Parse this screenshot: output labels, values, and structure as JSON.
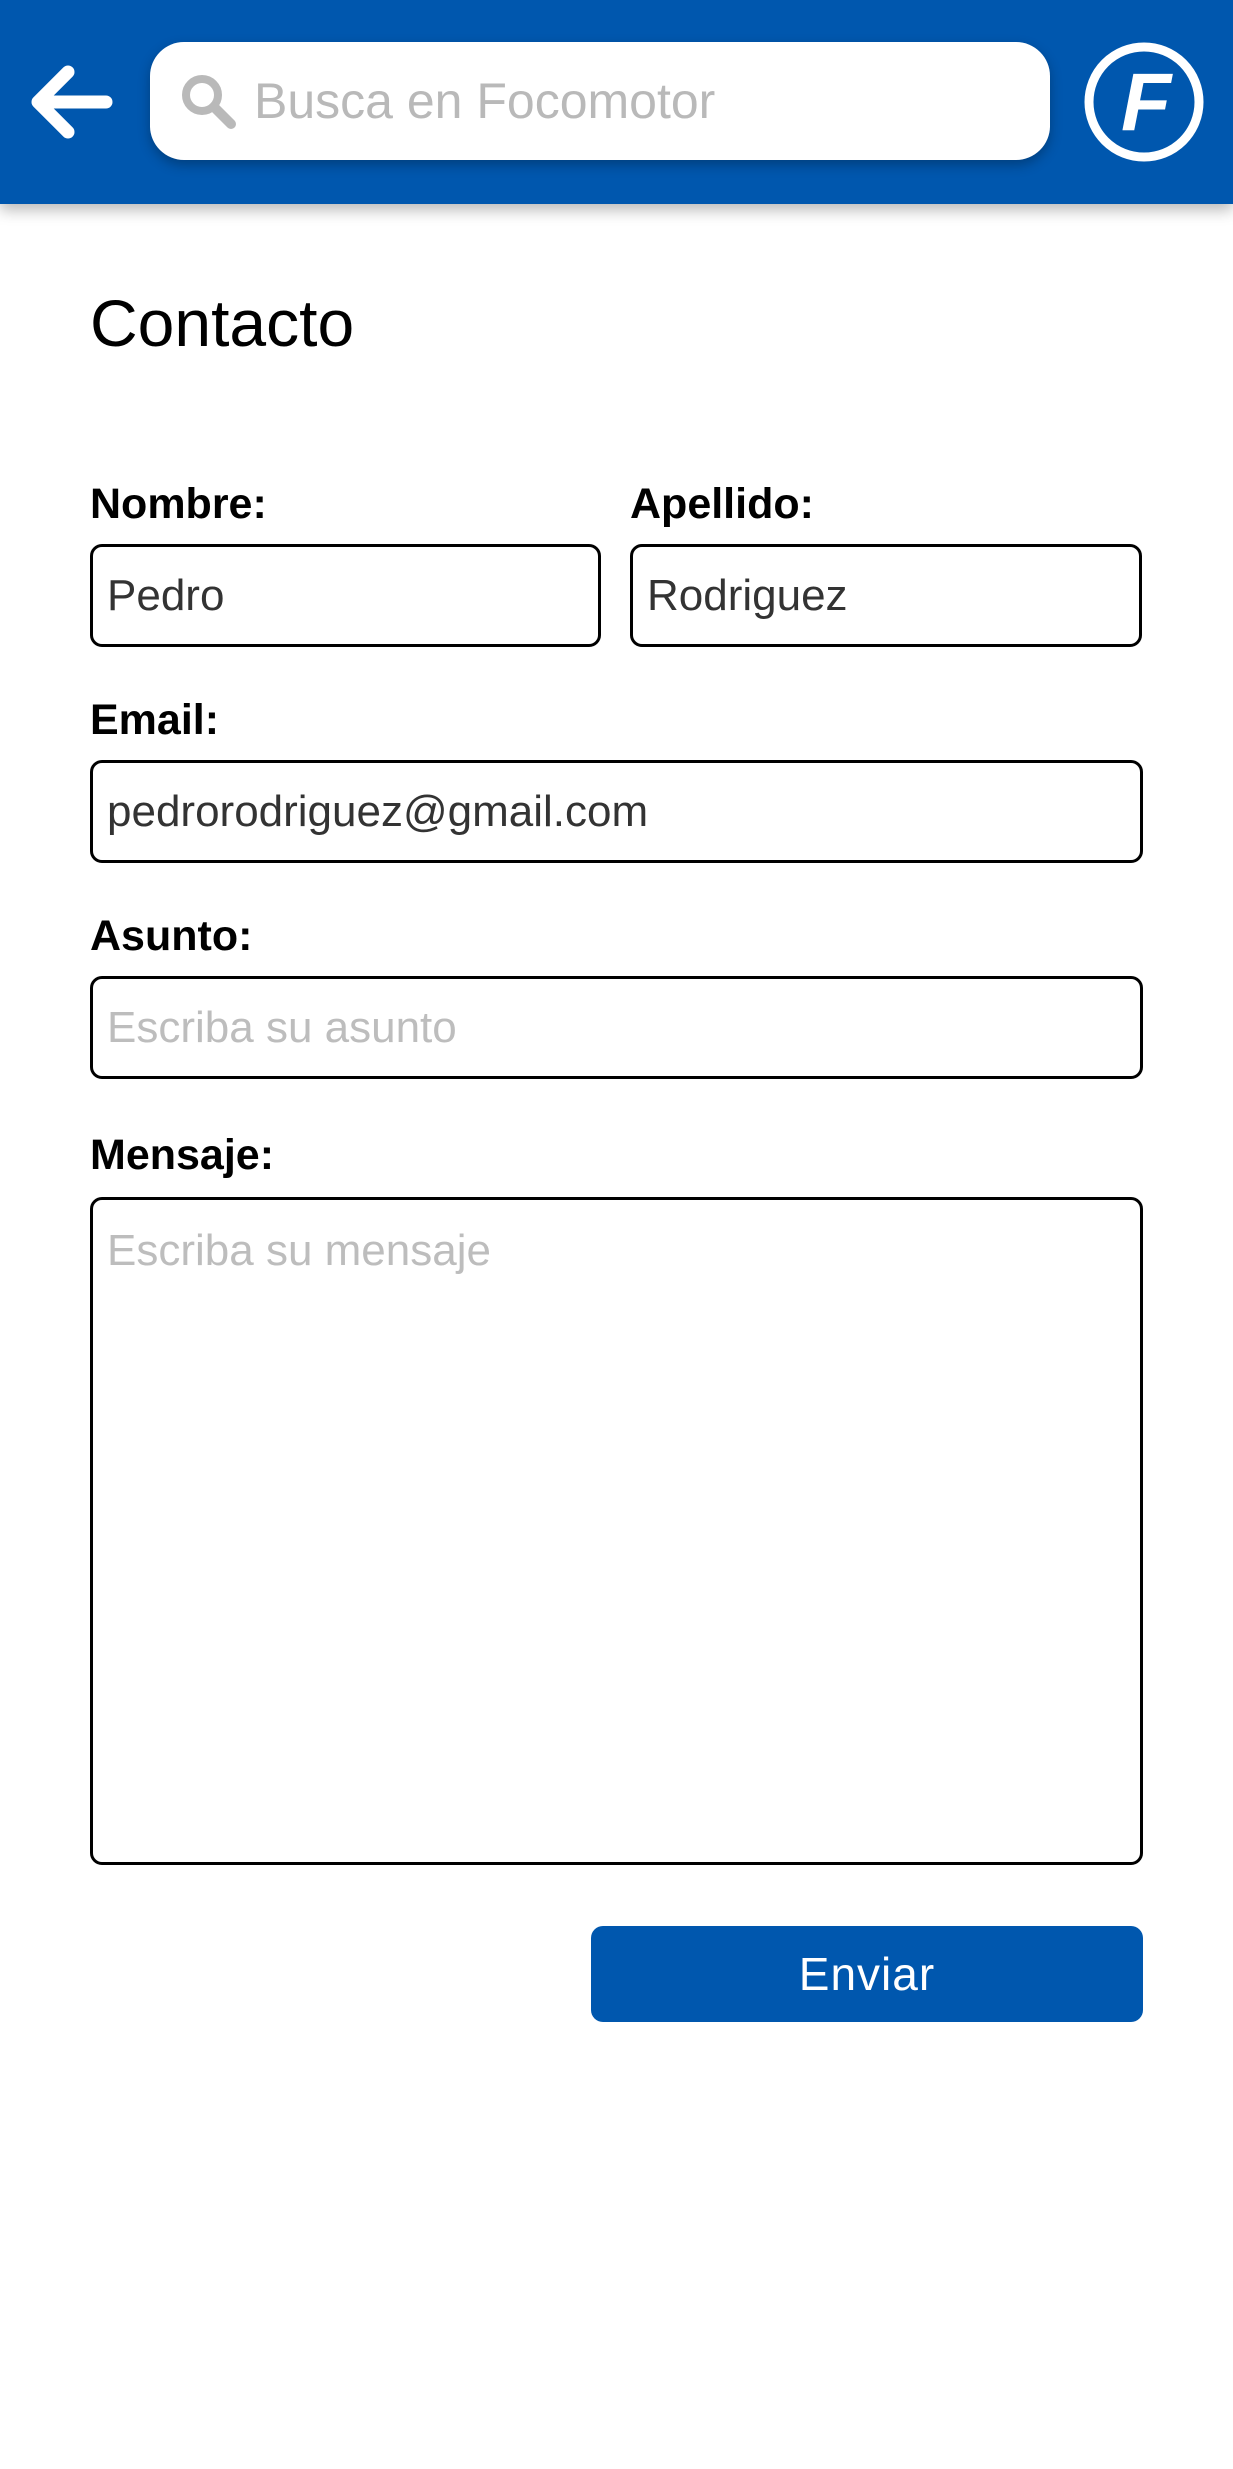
{
  "header": {
    "search": {
      "placeholder": "Busca en Focomotor",
      "value": ""
    },
    "logo_letter": "F",
    "icons": {
      "back": "arrow-left-icon",
      "search": "search-icon",
      "logo": "focomotor-logo"
    }
  },
  "form": {
    "title": "Contacto",
    "fields": {
      "nombre": {
        "label": "Nombre:",
        "value": "Pedro"
      },
      "apellido": {
        "label": "Apellido:",
        "value": "Rodriguez"
      },
      "email": {
        "label": "Email:",
        "value": "pedrorodriguez@gmail.com"
      },
      "asunto": {
        "label": "Asunto:",
        "value": "",
        "placeholder": "Escriba su asunto"
      },
      "mensaje": {
        "label": "Mensaje:",
        "value": "",
        "placeholder": "Escriba su mensaje"
      }
    },
    "submit_label": "Enviar"
  },
  "colors": {
    "brand_blue": "#0057ae",
    "text": "#000000",
    "placeholder": "#bdbdbd"
  }
}
